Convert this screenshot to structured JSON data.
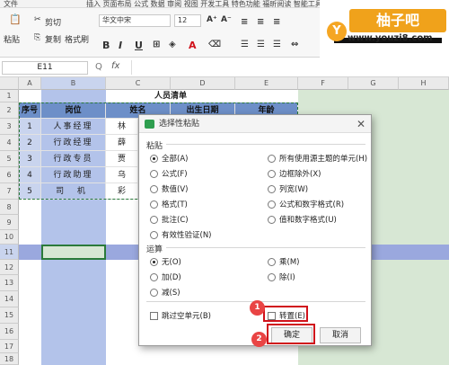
{
  "menu": {
    "file": "文件",
    "tail": "插入 页面布局 公式 数据 审阅 视图 开发工具 特色功能 福昕阅读 智能工具箱"
  },
  "ribbon": {
    "cut": "剪切",
    "paste": "粘贴",
    "copy": "复制",
    "format_painter": "格式刷",
    "font_name": "华文中宋",
    "font_size": "12",
    "bold": "B",
    "italic": "I",
    "underline": "U",
    "font_color_letter": "A",
    "grow": "A⁺",
    "shrink": "A⁻"
  },
  "brand": {
    "logo_char": "Y",
    "title": "柚子吧",
    "url": "www.youzi8.com"
  },
  "formula_bar": {
    "name_box": "E11",
    "fx": "fx",
    "zoom_q": "Q"
  },
  "sheet": {
    "columns": [
      "A",
      "B",
      "C",
      "D",
      "E",
      "F",
      "G",
      "H"
    ],
    "rows": [
      "1",
      "2",
      "3",
      "4",
      "5",
      "6",
      "7",
      "8",
      "9",
      "10",
      "11",
      "12",
      "13",
      "14",
      "15",
      "16",
      "17",
      "18"
    ],
    "title": "人员清单",
    "headers": [
      "序号",
      "岗位",
      "姓名",
      "出生日期",
      "年龄"
    ],
    "data": [
      [
        "1",
        "人事经理",
        "林"
      ],
      [
        "2",
        "行政经理",
        "薛"
      ],
      [
        "3",
        "行政专员",
        "贾"
      ],
      [
        "4",
        "行政助理",
        "乌"
      ],
      [
        "5",
        "司 机",
        "彩"
      ]
    ]
  },
  "dialog": {
    "title": "选择性粘贴",
    "paste_section": "粘贴",
    "paste_left": [
      "全部(A)",
      "公式(F)",
      "数值(V)",
      "格式(T)",
      "批注(C)",
      "有效性验证(N)"
    ],
    "paste_right": [
      "所有使用源主题的单元(H)",
      "边框除外(X)",
      "列宽(W)",
      "公式和数字格式(R)",
      "值和数字格式(U)"
    ],
    "op_section": "运算",
    "op_left": [
      "无(O)",
      "加(D)",
      "减(S)"
    ],
    "op_right": [
      "乘(M)",
      "除(I)"
    ],
    "skip_blanks": "跳过空单元(B)",
    "transpose": "转置(E)",
    "ok": "确定",
    "cancel": "取消"
  },
  "callouts": [
    "1",
    "2"
  ],
  "colors": {
    "accent_red": "#d0121b",
    "badge": "#e94444",
    "header_fill": "#6d8fc8",
    "selection_fill": "#b3c3ea",
    "row_highlight": "#9aa8de",
    "green_shade": "#d7e7d4",
    "brand_orange": "#f0a21b"
  }
}
